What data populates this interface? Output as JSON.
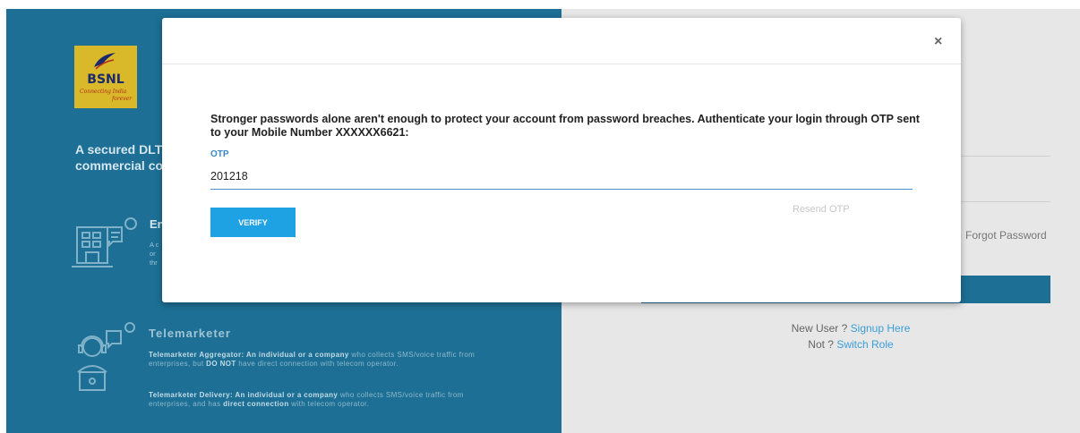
{
  "background": {
    "logo": {
      "text": "BSNL",
      "tagline_line1": "Connecting India",
      "tagline_line2": "forever"
    },
    "secured_line1": "A secured DLT",
    "secured_line2": "commercial co",
    "enterprise": {
      "title": "En",
      "desc_line1": "A c",
      "desc_line2": "or",
      "desc_line3": "thr"
    },
    "telemarketer": {
      "title": "Telemarketer",
      "aggregator_bold": "Telemarketer Aggregator: An individual or a company",
      "aggregator_text1": " who collects SMS/voice traffic from enterprises, but ",
      "aggregator_emph": "DO NOT",
      "aggregator_text2": " have direct connection with telecom operator.",
      "delivery_bold": "Telemarketer Delivery: An individual or a company",
      "delivery_text1": " who collects SMS/voice traffic from enterprises, and has ",
      "delivery_emph": "direct connection",
      "delivery_text2": " with telecom operator."
    },
    "forgot_password": "Forgot Password",
    "new_user_text": "New User ?",
    "signup_link": "Signup Here",
    "not_text": "Not ?",
    "switch_role_link": "Switch Role"
  },
  "modal": {
    "close_label": "×",
    "message": "Stronger passwords alone aren't enough to protect your account from password breaches. Authenticate your login through OTP sent to your Mobile Number XXXXXX6621:",
    "otp_label": "OTP",
    "otp_value": "201218",
    "verify_label": "VERIFY",
    "resend_label": "Resend OTP"
  },
  "colors": {
    "brand_blue": "#1d6f95",
    "button_blue": "#1fa2e3",
    "link_blue": "#3a9fd6",
    "logo_yellow": "#d9b829"
  }
}
